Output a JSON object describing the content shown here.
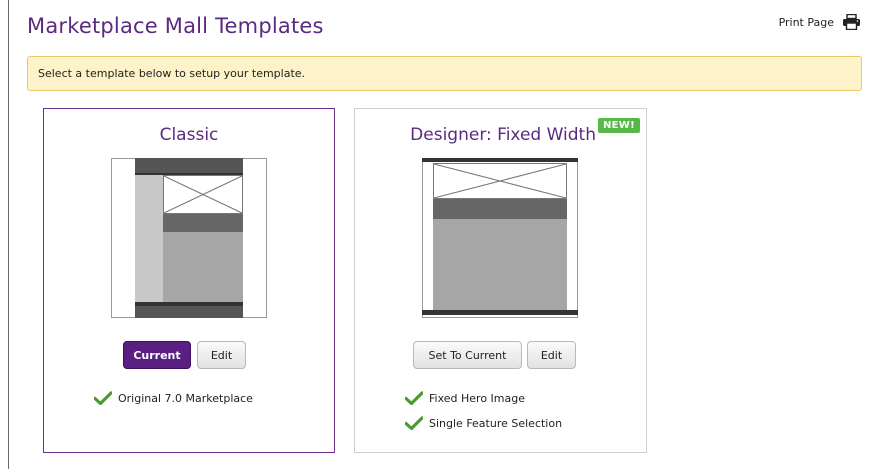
{
  "page": {
    "title": "Marketplace Mall Templates",
    "print_label": "Print Page",
    "notice": "Select a template below to setup your template."
  },
  "icons": {
    "print": "printer-icon",
    "check": "checkmark-icon"
  },
  "colors": {
    "brand_purple": "#5a2a82",
    "badge_green": "#55b847",
    "notice_bg": "#fdf2c8"
  },
  "templates": [
    {
      "title": "Classic",
      "badge": "",
      "is_current": true,
      "primary_button": "Current",
      "edit_button": "Edit",
      "features": [
        "Original 7.0 Marketplace"
      ]
    },
    {
      "title": "Designer: Fixed Width",
      "badge": "NEW!",
      "is_current": false,
      "primary_button": "Set To Current",
      "edit_button": "Edit",
      "features": [
        "Fixed Hero Image",
        "Single Feature Selection"
      ]
    }
  ]
}
